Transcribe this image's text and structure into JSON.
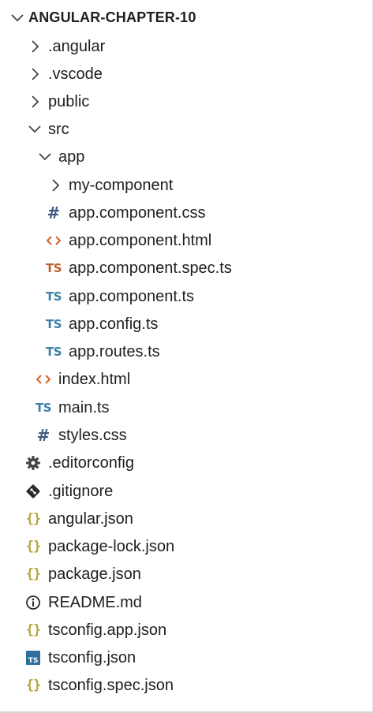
{
  "explorer": {
    "root_title": "ANGULAR-CHAPTER-10",
    "items": [
      {
        "label": ".angular",
        "type": "folder",
        "expanded": false,
        "icon": "chevron-right-icon"
      },
      {
        "label": ".vscode",
        "type": "folder",
        "expanded": false,
        "icon": "chevron-right-icon"
      },
      {
        "label": "public",
        "type": "folder",
        "expanded": false,
        "icon": "chevron-right-icon"
      },
      {
        "label": "src",
        "type": "folder",
        "expanded": true,
        "icon": "chevron-down-icon"
      },
      {
        "label": "app",
        "type": "folder",
        "expanded": true,
        "icon": "chevron-down-icon"
      },
      {
        "label": "my-component",
        "type": "folder",
        "expanded": false,
        "icon": "chevron-right-icon"
      },
      {
        "label": "app.component.css",
        "type": "file",
        "icon": "css-hash-icon"
      },
      {
        "label": "app.component.html",
        "type": "file",
        "icon": "html-brackets-icon"
      },
      {
        "label": "app.component.spec.ts",
        "type": "file",
        "icon": "ts-spec-icon"
      },
      {
        "label": "app.component.ts",
        "type": "file",
        "icon": "ts-icon"
      },
      {
        "label": "app.config.ts",
        "type": "file",
        "icon": "ts-icon"
      },
      {
        "label": "app.routes.ts",
        "type": "file",
        "icon": "ts-icon"
      },
      {
        "label": "index.html",
        "type": "file",
        "icon": "html-brackets-icon"
      },
      {
        "label": "main.ts",
        "type": "file",
        "icon": "ts-icon"
      },
      {
        "label": "styles.css",
        "type": "file",
        "icon": "css-hash-icon"
      },
      {
        "label": ".editorconfig",
        "type": "file",
        "icon": "gear-icon"
      },
      {
        "label": ".gitignore",
        "type": "file",
        "icon": "git-icon"
      },
      {
        "label": "angular.json",
        "type": "file",
        "icon": "json-braces-icon"
      },
      {
        "label": "package-lock.json",
        "type": "file",
        "icon": "json-braces-icon"
      },
      {
        "label": "package.json",
        "type": "file",
        "icon": "json-braces-icon"
      },
      {
        "label": "README.md",
        "type": "file",
        "icon": "info-icon"
      },
      {
        "label": "tsconfig.app.json",
        "type": "file",
        "icon": "json-braces-icon"
      },
      {
        "label": "tsconfig.json",
        "type": "file",
        "icon": "tsconfig-icon"
      },
      {
        "label": "tsconfig.spec.json",
        "type": "file",
        "icon": "json-braces-icon"
      }
    ]
  },
  "colors": {
    "chevron": "#424242",
    "css_hash": "#1f6feb",
    "html_brackets": "#d0652e",
    "ts": "#3e7fa8",
    "ts_spec": "#c0602f",
    "json_braces": "#b7a63a",
    "gear": "#424242",
    "git": "#2b2b2b",
    "info": "#2b2b2b",
    "tsconfig": "#2f6f9f"
  }
}
